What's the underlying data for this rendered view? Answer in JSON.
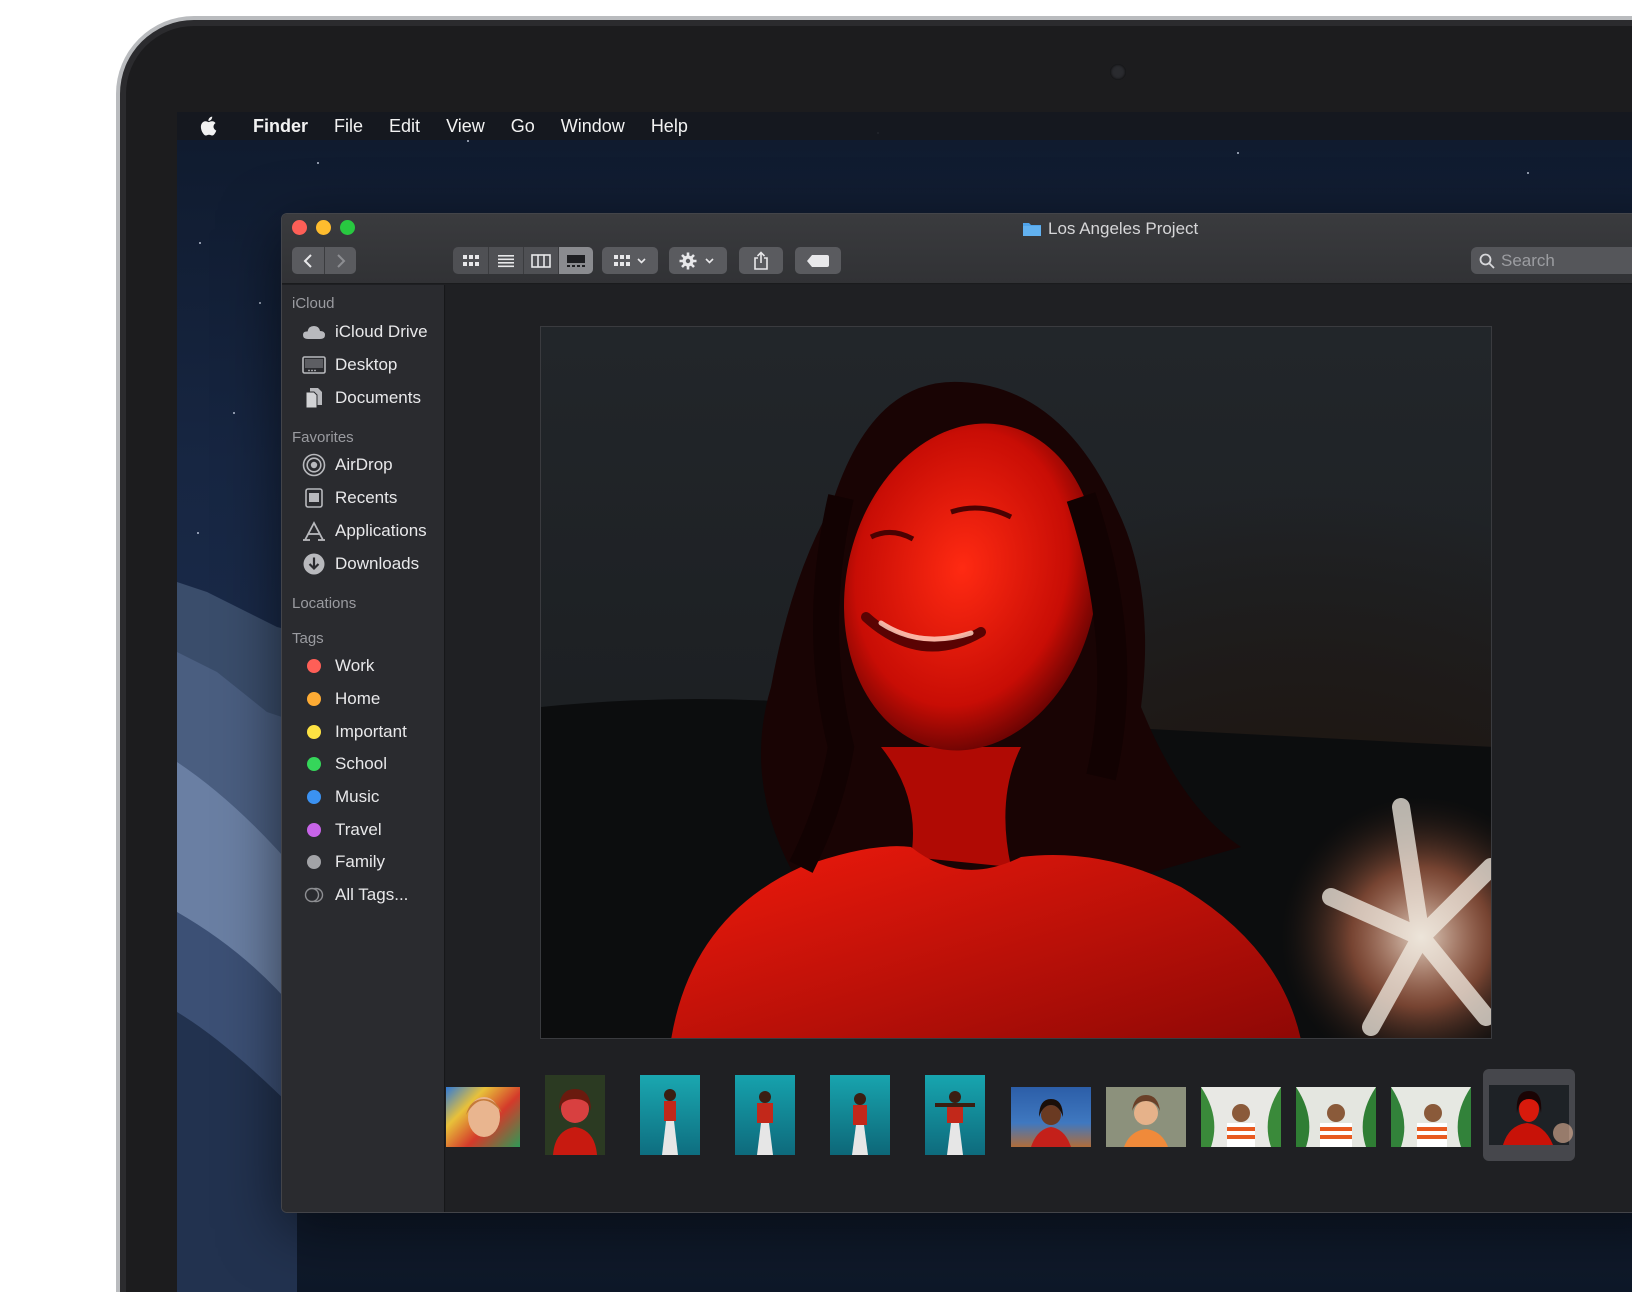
{
  "menubar": {
    "app": "Finder",
    "items": [
      "File",
      "Edit",
      "View",
      "Go",
      "Window",
      "Help"
    ]
  },
  "window": {
    "title": "Los Angeles Project",
    "search_placeholder": "Search"
  },
  "sidebar": {
    "icloud": {
      "heading": "iCloud",
      "items": [
        "iCloud Drive",
        "Desktop",
        "Documents"
      ]
    },
    "favorites": {
      "heading": "Favorites",
      "items": [
        "AirDrop",
        "Recents",
        "Applications",
        "Downloads"
      ]
    },
    "locations": {
      "heading": "Locations"
    },
    "tags": {
      "heading": "Tags",
      "items": [
        {
          "label": "Work",
          "color": "#fe5f57"
        },
        {
          "label": "Home",
          "color": "#fdab34"
        },
        {
          "label": "Important",
          "color": "#fde243"
        },
        {
          "label": "School",
          "color": "#35d65a"
        },
        {
          "label": "Music",
          "color": "#3b92f2"
        },
        {
          "label": "Travel",
          "color": "#c764e8"
        },
        {
          "label": "Family",
          "color": "#a2a3a7"
        },
        {
          "label": "All Tags...",
          "color": "none"
        }
      ]
    }
  },
  "colors": {
    "accent_folder": "#4fa3ea",
    "window_bg": "#1e1f22",
    "sidebar_bg": "#2a2b2f"
  }
}
